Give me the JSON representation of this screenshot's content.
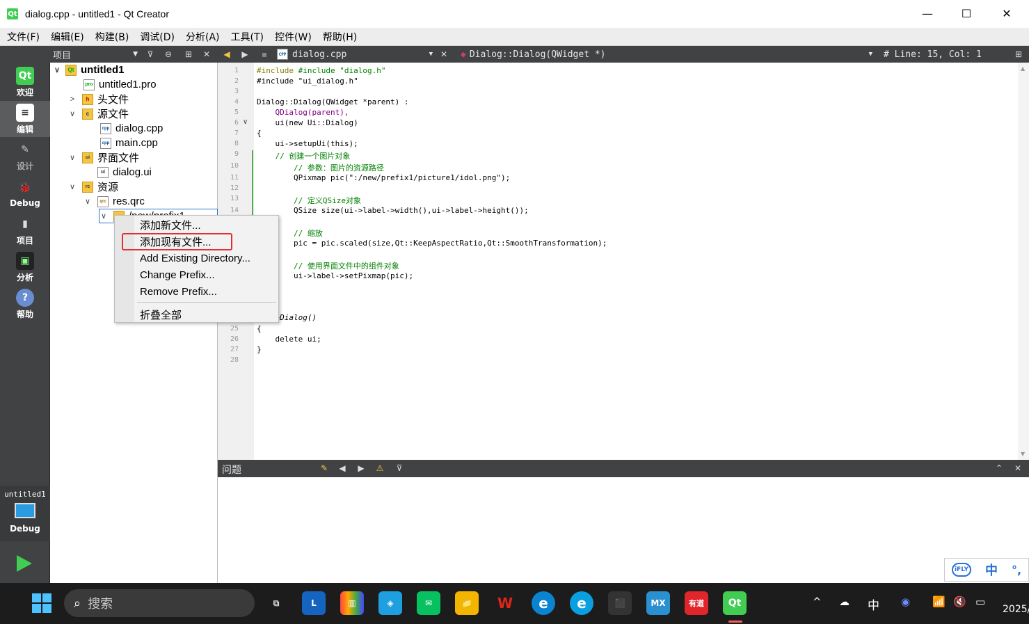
{
  "window": {
    "title": "dialog.cpp - untitled1 - Qt Creator",
    "qt_badge": "Qt",
    "minimize": "—",
    "maximize": "☐",
    "close": "✕"
  },
  "menu": [
    "文件(F)",
    "编辑(E)",
    "构建(B)",
    "调试(D)",
    "分析(A)",
    "工具(T)",
    "控件(W)",
    "帮助(H)"
  ],
  "toolstrip": {
    "project_selector": "项目",
    "file_selector": "dialog.cpp",
    "symbol_selector": "Dialog::Dialog(QWidget *)",
    "position": "#  Line: 15, Col: 1"
  },
  "modes": [
    {
      "label": "欢迎",
      "icon": "Qt"
    },
    {
      "label": "编辑",
      "icon": "≡"
    },
    {
      "label": "设计",
      "icon": "✎"
    },
    {
      "label": "Debug",
      "icon": "🐞"
    },
    {
      "label": "项目",
      "icon": "▮"
    },
    {
      "label": "分析",
      "icon": "▣"
    },
    {
      "label": "帮助",
      "icon": "?"
    }
  ],
  "kit": {
    "project": "untitled1",
    "config": "Debug"
  },
  "tree": [
    {
      "label": "untitled1",
      "arrow": "∨",
      "icon": "Qt"
    },
    {
      "label": "untitled1.pro",
      "arrow": "",
      "icon": "pro"
    },
    {
      "label": "头文件",
      "arrow": ">",
      "icon": "h"
    },
    {
      "label": "源文件",
      "arrow": "∨",
      "icon": "c"
    },
    {
      "label": "dialog.cpp",
      "arrow": "",
      "icon": "cpp"
    },
    {
      "label": "main.cpp",
      "arrow": "",
      "icon": "cpp"
    },
    {
      "label": "界面文件",
      "arrow": "∨",
      "icon": "ui"
    },
    {
      "label": "dialog.ui",
      "arrow": "",
      "icon": "ui"
    },
    {
      "label": "资源",
      "arrow": "∨",
      "icon": "rc"
    },
    {
      "label": "res.qrc",
      "arrow": "∨",
      "icon": "qrc"
    },
    {
      "label": "/new/prefix1",
      "arrow": "∨",
      "icon": ""
    }
  ],
  "context_menu": [
    "添加新文件...",
    "添加现有文件...",
    "Add Existing Directory...",
    "Change Prefix...",
    "Remove Prefix...",
    "折叠全部"
  ],
  "line_numbers": [
    "1",
    "2",
    "3",
    "4",
    "5",
    "6",
    "7",
    "8",
    "9",
    "10",
    "11",
    "12",
    "13",
    "14",
    "25",
    "26",
    "27",
    "28"
  ],
  "code": [
    "#include \"dialog.h\"",
    "#include \"ui_dialog.h\"",
    "",
    "Dialog::Dialog(QWidget *parent) :",
    "    QDialog(parent),",
    "    ui(new Ui::Dialog)",
    "{",
    "    ui->setupUi(this);",
    "    // 创建一个图片对象",
    "        // 参数：图片的资源路径",
    "        QPixmap pic(\":/new/prefix1/picture1/idol.png\");",
    "",
    "        // 定义QSize对象",
    "        QSize size(ui->label->width(),ui->label->height());",
    "",
    "        // 缩放",
    "        pic = pic.scaled(size,Qt::KeepAspectRatio,Qt::SmoothTransformation);",
    "",
    "        // 使用界面文件中的组件对象",
    "        ui->label->setPixmap(pic);",
    "",
    "",
    "",
    "og::~Dialog()",
    "{",
    "    delete ui;",
    "}"
  ],
  "issues_panel": {
    "title": "问题"
  },
  "ime": {
    "logo": "iFLY",
    "lang": "中",
    "mode": "°,"
  },
  "taskbar": {
    "search": "搜索",
    "apps": [
      "⧉",
      "L",
      "▥",
      "◈",
      "✉",
      "📁",
      "W",
      "e",
      "e",
      "⬛",
      "MX",
      "有道",
      "Qt"
    ],
    "tray": [
      "^",
      "☁",
      "中",
      "◉",
      "📶",
      "🔇",
      "▭"
    ],
    "clock": "2025/"
  },
  "colors": {
    "highlight_box": "#e03030",
    "sidebar": "#404244",
    "accent": "#41cd52"
  }
}
